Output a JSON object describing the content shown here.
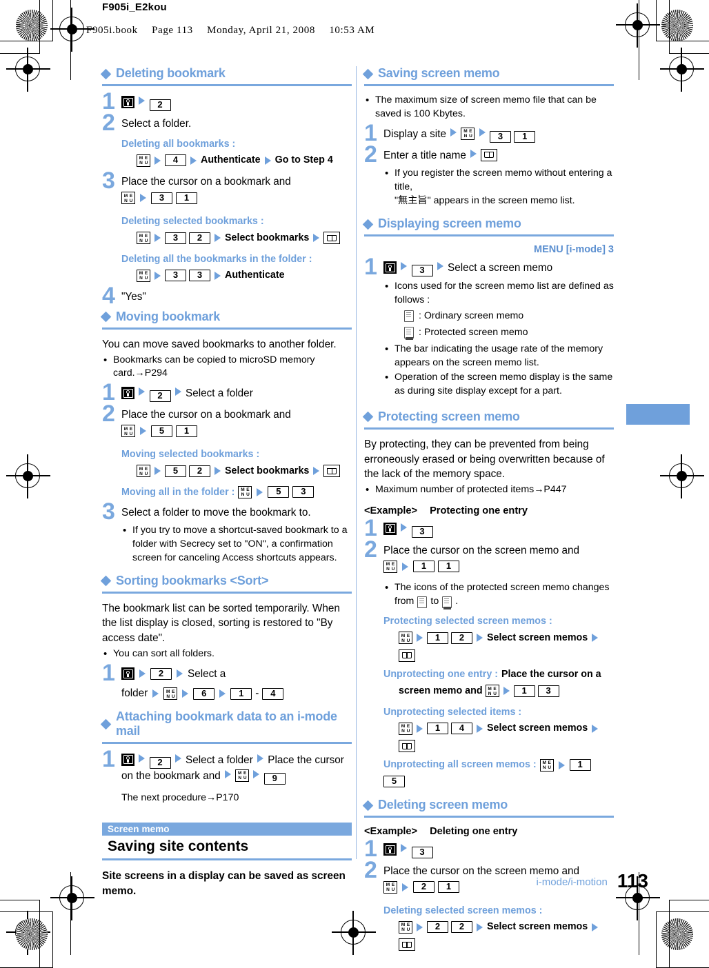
{
  "header": {
    "doc_id": "F905i_E2kou",
    "book_file": "F905i.book",
    "book_page": "Page 113",
    "book_day": "Monday, April 21, 2008",
    "book_time": "10:53 AM"
  },
  "colors": {
    "accent_blue": "#7aa8de",
    "heading_blue": "#6fa0db",
    "band_blue": "#7aa8de"
  },
  "icons": {
    "imode": "imode-key-icon",
    "menu": "menu-key-icon",
    "confirm": "confirm-book-key-icon",
    "arrow": "arrow-right-icon",
    "memo_ordinary": "screen-memo-ordinary-icon",
    "memo_protected": "screen-memo-protected-icon"
  },
  "left": {
    "s1": {
      "heading": "Deleting bookmark",
      "step1_num": "1",
      "step2_num": "2",
      "step2_text": "Select a folder.",
      "sub1_label": "Deleting all bookmarks :",
      "sub1_key": "4",
      "sub1_auth": "Authenticate",
      "sub1_goto": "Go to Step 4",
      "step3_num": "3",
      "step3_text": "Place the cursor on a bookmark and",
      "step3_k1": "3",
      "step3_k2": "1",
      "sub2_label": "Deleting selected bookmarks :",
      "sub2_k1": "3",
      "sub2_k2": "2",
      "sub2_text": "Select bookmarks",
      "sub3_label": "Deleting all the bookmarks in the folder :",
      "sub3_k1": "3",
      "sub3_k2": "3",
      "sub3_text": "Authenticate",
      "step4_num": "4",
      "step4_text": "\"Yes\"",
      "key2": "2"
    },
    "s2": {
      "heading": "Moving bookmark",
      "intro": "You can move saved bookmarks to another folder.",
      "bullet1": "Bookmarks can be copied to microSD memory card.→P294",
      "step1_num": "1",
      "step1_k": "2",
      "step1_text": "Select a folder",
      "step2_num": "2",
      "step2_text": "Place the cursor on a bookmark and",
      "step2_k1": "5",
      "step2_k2": "1",
      "sub1_label": "Moving selected bookmarks :",
      "sub1_k1": "5",
      "sub1_k2": "2",
      "sub1_text": "Select bookmarks",
      "sub2_label": "Moving all in the folder :",
      "sub2_k1": "5",
      "sub2_k2": "3",
      "step3_num": "3",
      "step3_text": "Select a folder to move the bookmark to.",
      "step3_bullet": "If you try to move a shortcut-saved bookmark to a folder with Secrecy set to \"ON\", a confirmation screen for canceling Access shortcuts appears."
    },
    "s3": {
      "heading": "Sorting bookmarks <Sort>",
      "intro": "The bookmark list can be sorted temporarily. When the list display is closed, sorting is restored to \"By access date\".",
      "bullet1": "You can sort all folders.",
      "step1_num": "1",
      "step1_k1": "2",
      "step1_t1": "Select a",
      "step1_t2": "folder",
      "step1_k2": "6",
      "step1_k3": "1",
      "step1_dash": "-",
      "step1_k4": "4"
    },
    "s4": {
      "heading": "Attaching bookmark data to an i-mode mail",
      "step1_num": "1",
      "step1_k1": "2",
      "step1_t1": "Select a folder",
      "step1_t2": "Place the cursor on the bookmark and",
      "step1_k2": "9",
      "note": "The next procedure→P170"
    },
    "s5": {
      "band": "Screen memo",
      "title": "Saving site contents",
      "lead": "Site screens in a display can be saved as screen memo."
    }
  },
  "right": {
    "s1": {
      "heading": "Saving screen memo",
      "bullet1": "The maximum size of screen memo file that can be saved is 100 Kbytes.",
      "step1_num": "1",
      "step1_text": "Display a site",
      "step1_k1": "3",
      "step1_k2": "1",
      "step2_num": "2",
      "step2_text": "Enter a title name",
      "step2_bullet": "If you register the screen memo without entering a title,",
      "step2_bullet2": "\"無主旨\" appears in the screen memo list."
    },
    "s2": {
      "heading": "Displaying screen memo",
      "menu_path": "MENU [i-mode] 3",
      "step1_num": "1",
      "step1_k": "3",
      "step1_text": "Select a screen memo",
      "bullet1": "Icons used for the screen memo list are defined as follows :",
      "def1": ": Ordinary screen memo",
      "def2": ": Protected screen memo",
      "bullet2": "The bar indicating the usage rate of the memory appears on the screen memo list.",
      "bullet3": "Operation of the screen memo display is the same as during site display except for a part."
    },
    "s3": {
      "heading": "Protecting screen memo",
      "intro": "By protecting, they can be prevented from being erroneously erased or being overwritten because of the lack of the memory space.",
      "bullet1": "Maximum number of protected items→P447",
      "example_tag": "<Example>",
      "example_text": "Protecting one entry",
      "step1_num": "1",
      "step1_k": "3",
      "step2_num": "2",
      "step2_text": "Place the cursor on the screen memo and",
      "step2_k1": "1",
      "step2_k2": "1",
      "step2_bullet_a": "The icons of the protected screen memo changes",
      "step2_bullet_b": "from",
      "step2_bullet_c": "to",
      "step2_bullet_d": ".",
      "sub1_label": "Protecting selected screen memos :",
      "sub1_k1": "1",
      "sub1_k2": "2",
      "sub1_text": "Select screen memos",
      "sub2_label": "Unprotecting one entry :",
      "sub2_text_a": "Place the cursor on a",
      "sub2_text_b": "screen memo and",
      "sub2_k1": "1",
      "sub2_k2": "3",
      "sub3_label": "Unprotecting selected items :",
      "sub3_k1": "1",
      "sub3_k2": "4",
      "sub3_text": "Select screen memos",
      "sub4_label": "Unprotecting all screen memos :",
      "sub4_k1": "1",
      "sub4_k2": "5"
    },
    "s4": {
      "heading": "Deleting screen memo",
      "example_tag": "<Example>",
      "example_text": "Deleting one entry",
      "step1_num": "1",
      "step1_k": "3",
      "step2_num": "2",
      "step2_text": "Place the cursor on the screen memo and",
      "step2_k1": "2",
      "step2_k2": "1",
      "sub1_label": "Deleting selected screen memos :",
      "sub1_k1": "2",
      "sub1_k2": "2",
      "sub1_text": "Select screen memos"
    }
  },
  "footer": {
    "section": "i-mode/i-motion",
    "page_number": "113"
  }
}
